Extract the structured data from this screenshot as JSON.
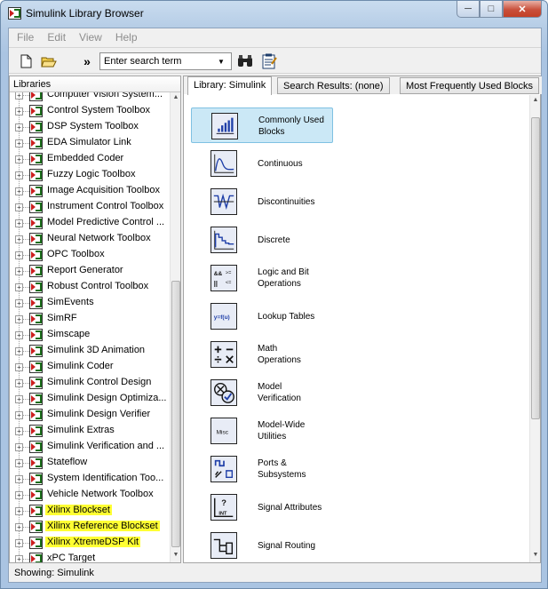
{
  "window": {
    "title": "Simulink Library Browser"
  },
  "menu": [
    "File",
    "Edit",
    "View",
    "Help"
  ],
  "toolbar": {
    "more": "»",
    "search_value": "Enter search term"
  },
  "left": {
    "header": "Libraries",
    "items": [
      {
        "label": "Computer Vision System...",
        "hl": false
      },
      {
        "label": "Control System Toolbox",
        "hl": false
      },
      {
        "label": "DSP System Toolbox",
        "hl": false
      },
      {
        "label": "EDA Simulator Link",
        "hl": false
      },
      {
        "label": "Embedded Coder",
        "hl": false
      },
      {
        "label": "Fuzzy Logic Toolbox",
        "hl": false
      },
      {
        "label": "Image Acquisition Toolbox",
        "hl": false
      },
      {
        "label": "Instrument Control Toolbox",
        "hl": false
      },
      {
        "label": "Model Predictive Control ...",
        "hl": false
      },
      {
        "label": "Neural Network Toolbox",
        "hl": false
      },
      {
        "label": "OPC Toolbox",
        "hl": false
      },
      {
        "label": "Report Generator",
        "hl": false
      },
      {
        "label": "Robust Control Toolbox",
        "hl": false
      },
      {
        "label": "SimEvents",
        "hl": false
      },
      {
        "label": "SimRF",
        "hl": false
      },
      {
        "label": "Simscape",
        "hl": false
      },
      {
        "label": "Simulink 3D Animation",
        "hl": false
      },
      {
        "label": "Simulink Coder",
        "hl": false
      },
      {
        "label": "Simulink Control Design",
        "hl": false
      },
      {
        "label": "Simulink Design Optimiza...",
        "hl": false
      },
      {
        "label": "Simulink Design Verifier",
        "hl": false
      },
      {
        "label": "Simulink Extras",
        "hl": false
      },
      {
        "label": "Simulink Verification and ...",
        "hl": false
      },
      {
        "label": "Stateflow",
        "hl": false
      },
      {
        "label": "System Identification Too...",
        "hl": false
      },
      {
        "label": "Vehicle Network Toolbox",
        "hl": false
      },
      {
        "label": "Xilinx Blockset",
        "hl": true
      },
      {
        "label": "Xilinx Reference Blockset",
        "hl": true
      },
      {
        "label": "Xilinx XtremeDSP Kit",
        "hl": true
      },
      {
        "label": "xPC Target",
        "hl": false
      }
    ]
  },
  "tabs": [
    "Library: Simulink",
    "Search Results: (none)",
    "Most Frequently Used Blocks"
  ],
  "libraries": [
    {
      "label": "Commonly Used\nBlocks",
      "icon": "commonly-used-icon"
    },
    {
      "label": "Continuous",
      "icon": "continuous-icon"
    },
    {
      "label": "Discontinuities",
      "icon": "discontinuities-icon"
    },
    {
      "label": "Discrete",
      "icon": "discrete-icon"
    },
    {
      "label": "Logic and Bit\nOperations",
      "icon": "logic-icon"
    },
    {
      "label": "Lookup Tables",
      "icon": "lookup-icon"
    },
    {
      "label": "Math\nOperations",
      "icon": "math-icon"
    },
    {
      "label": "Model\nVerification",
      "icon": "verification-icon"
    },
    {
      "label": "Model-Wide\nUtilities",
      "icon": "utilities-icon"
    },
    {
      "label": "Ports &\nSubsystems",
      "icon": "ports-icon"
    },
    {
      "label": "Signal Attributes",
      "icon": "signal-attributes-icon"
    },
    {
      "label": "Signal Routing",
      "icon": "signal-routing-icon"
    }
  ],
  "icon_text": {
    "lookup": "y=f(u)",
    "misc": "Misc"
  },
  "status": "Showing: Simulink"
}
